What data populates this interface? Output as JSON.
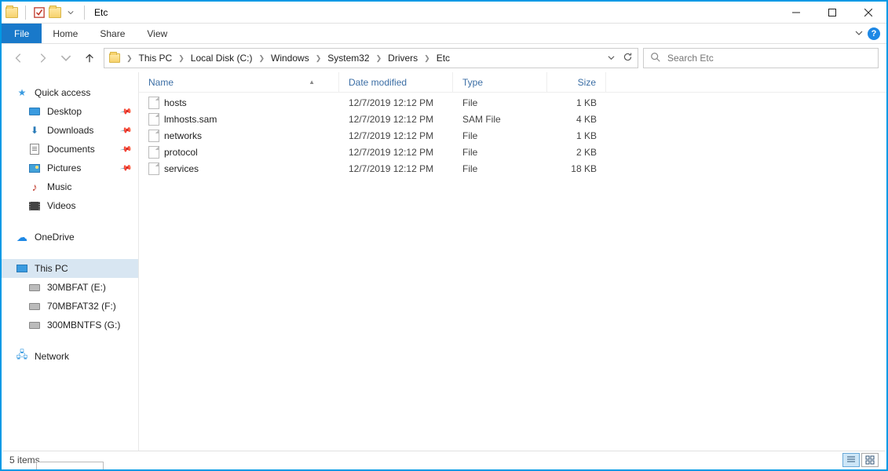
{
  "window": {
    "title": "Etc"
  },
  "ribbon": {
    "file": "File",
    "tabs": [
      "Home",
      "Share",
      "View"
    ]
  },
  "breadcrumb": [
    "This PC",
    "Local Disk (C:)",
    "Windows",
    "System32",
    "Drivers",
    "Etc"
  ],
  "search": {
    "placeholder": "Search Etc"
  },
  "sidebar": {
    "quick_access": "Quick access",
    "quick_items": [
      {
        "label": "Desktop",
        "pinned": true
      },
      {
        "label": "Downloads",
        "pinned": true
      },
      {
        "label": "Documents",
        "pinned": true
      },
      {
        "label": "Pictures",
        "pinned": true
      },
      {
        "label": "Music",
        "pinned": false
      },
      {
        "label": "Videos",
        "pinned": false
      }
    ],
    "onedrive": "OneDrive",
    "this_pc": "This PC",
    "drives": [
      {
        "label": "30MBFAT (E:)"
      },
      {
        "label": "70MBFAT32 (F:)"
      },
      {
        "label": "300MBNTFS (G:)"
      }
    ],
    "network": "Network"
  },
  "columns": {
    "name": "Name",
    "date": "Date modified",
    "type": "Type",
    "size": "Size"
  },
  "files": [
    {
      "name": "hosts",
      "date": "12/7/2019 12:12 PM",
      "type": "File",
      "size": "1 KB"
    },
    {
      "name": "lmhosts.sam",
      "date": "12/7/2019 12:12 PM",
      "type": "SAM File",
      "size": "4 KB"
    },
    {
      "name": "networks",
      "date": "12/7/2019 12:12 PM",
      "type": "File",
      "size": "1 KB"
    },
    {
      "name": "protocol",
      "date": "12/7/2019 12:12 PM",
      "type": "File",
      "size": "2 KB"
    },
    {
      "name": "services",
      "date": "12/7/2019 12:12 PM",
      "type": "File",
      "size": "18 KB"
    }
  ],
  "status": {
    "item_count": "5 items"
  }
}
